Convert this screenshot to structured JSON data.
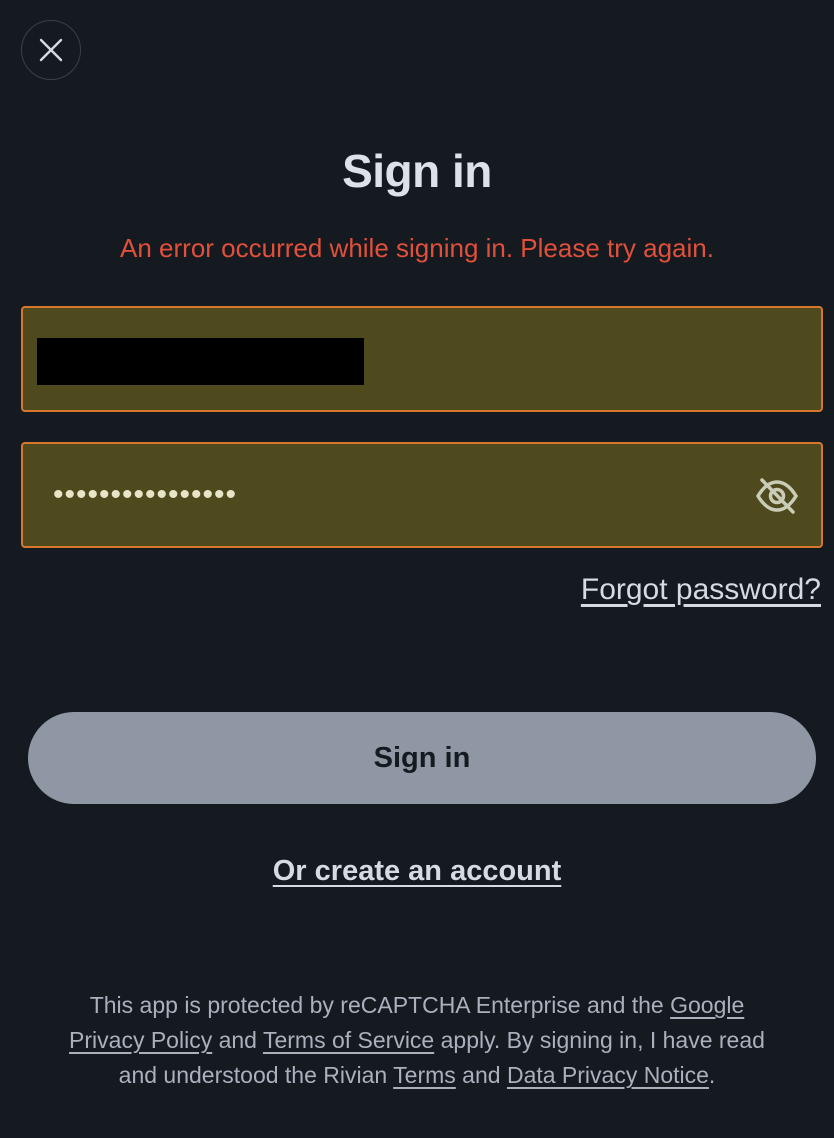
{
  "header": {
    "close_icon": "close-icon"
  },
  "title": "Sign in",
  "error_message": "An error occurred while signing in. Please try again.",
  "email_field": {
    "value": "",
    "redacted": true
  },
  "password_field": {
    "masked_value": "••••••••••••••••",
    "toggle_icon": "eye-off-icon"
  },
  "forgot_password": "Forgot password?",
  "sign_in_button": "Sign in",
  "create_account": "Or create an account",
  "legal": {
    "text_1": "This app is protected by reCAPTCHA Enterprise and the ",
    "google_link": "Google",
    "privacy_link": "Privacy Policy",
    "text_2": " and ",
    "tos_link": "Terms of Service",
    "text_3": " apply. By signing in, I have read and understood the Rivian ",
    "terms_link": "Terms",
    "text_4": " and ",
    "data_privacy_link": "Data Privacy Notice",
    "text_5": "."
  },
  "colors": {
    "background": "#151920",
    "error": "#e0503a",
    "field_fill": "#4f4a1d",
    "field_border": "#d6782c",
    "button": "#8e97a3"
  }
}
